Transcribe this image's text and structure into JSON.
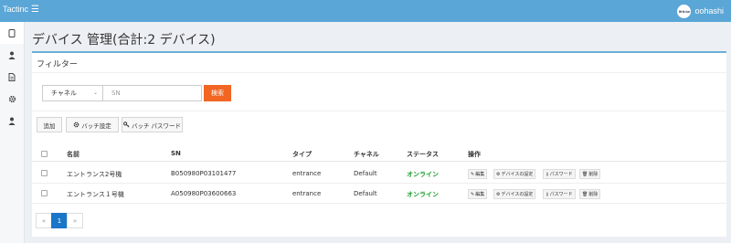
{
  "topbar": {
    "brand": "Tactinc",
    "menu_icon": "☰",
    "username": "oohashi",
    "avatar_text": "Ifrit.be"
  },
  "sidebar": {
    "items": [
      "devices",
      "users",
      "documents",
      "settings",
      "account"
    ]
  },
  "page": {
    "title": "デバイス 管理(合計:2 デバイス)"
  },
  "filter": {
    "title": "フィルター",
    "channel_value": "チャネル",
    "sn_placeholder": "SN",
    "search_label": "検索"
  },
  "toolbar": {
    "add_label": "追加",
    "batch_settings_label": "バッチ設定",
    "batch_password_label": "バッチ パスワード"
  },
  "table": {
    "headers": {
      "name": "名前",
      "sn": "SN",
      "type": "タイプ",
      "channel": "チャネル",
      "status": "ステータス",
      "actions": "操作"
    },
    "rows": [
      {
        "name": "エントランス2号機",
        "sn": "B050980P03101477",
        "type": "entrance",
        "channel": "Default",
        "status": "オンライン"
      },
      {
        "name": "エントランス１号機",
        "sn": "A050980P03600663",
        "type": "entrance",
        "channel": "Default",
        "status": "オンライン"
      }
    ],
    "actions": {
      "edit": "編集",
      "device_settings": "デバイスの設定",
      "password": "パスワード",
      "delete": "削除"
    }
  },
  "pagination": {
    "prev": "«",
    "current": "1",
    "next": "»"
  },
  "colors": {
    "topbar": "#5aa6d6",
    "search_button": "#f26522",
    "status_online": "#1b9c2b",
    "page_active": "#1976c8"
  }
}
